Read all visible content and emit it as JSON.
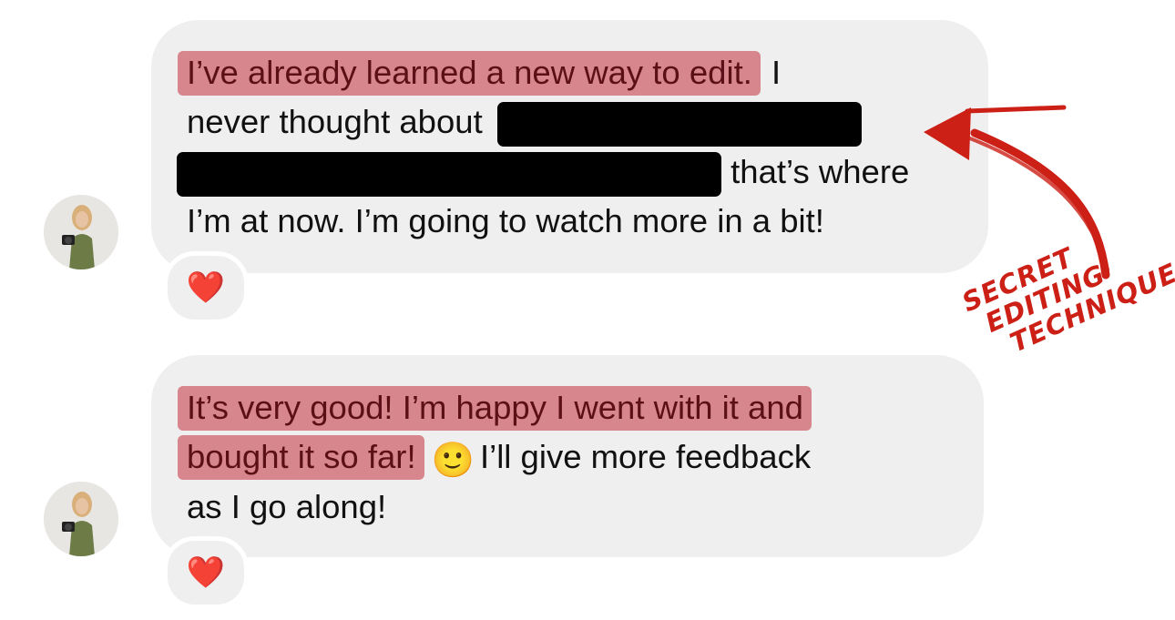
{
  "conversation": {
    "messages": [
      {
        "highlight": "I’ve already learned a new way to edit.",
        "line1_rest": " I",
        "line2": "never thought about ",
        "line3_after_redaction": " that’s where",
        "line4": "I’m at now. I’m going to watch more in a bit!",
        "reaction": "❤️"
      },
      {
        "highlight_line1": "It’s very good! I’m happy I went with it and",
        "highlight_line2": "bought it so far!",
        "emoji": "🙂",
        "line2_rest": "I’ll give more feedback",
        "line3": "as I go along!",
        "reaction": "❤️"
      }
    ]
  },
  "annotation": {
    "lines": [
      "SECRET",
      "EDITING",
      "TECHNIQUE"
    ],
    "color": "#cc1f16"
  },
  "colors": {
    "bubble": "#efefef",
    "highlight": "#d8868d",
    "highlight_text": "#5b0f17",
    "redaction": "#000000"
  }
}
